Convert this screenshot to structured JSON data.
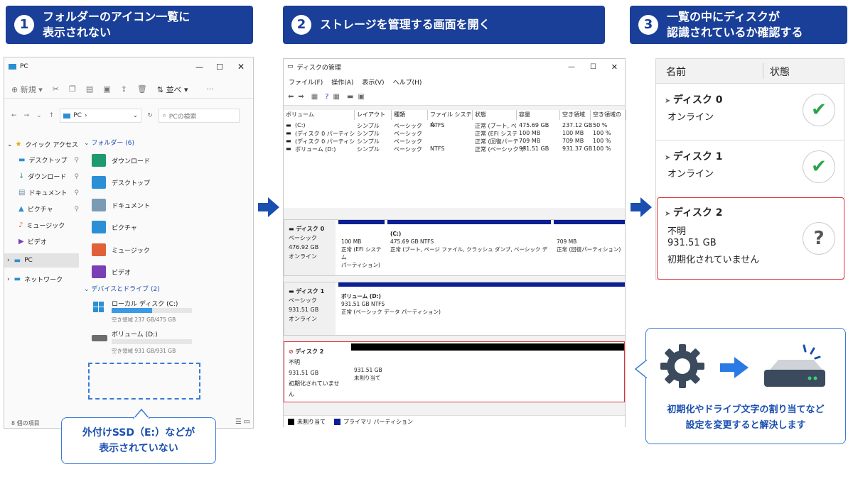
{
  "steps": [
    {
      "num": "1",
      "text": "フォルダーのアイコン一覧に\n表示されない"
    },
    {
      "num": "2",
      "text": "ストレージを管理する画面を開く"
    },
    {
      "num": "3",
      "text": "一覧の中にディスクが\n認識されているか確認する"
    }
  ],
  "explorer": {
    "title": "PC",
    "toolbar": {
      "new": "新規",
      "sort": "並べ",
      "view": "表示"
    },
    "address": "PC",
    "search_placeholder": "PCの検索",
    "nav": [
      {
        "label": "クイック アクセス",
        "icon": "star-icon"
      },
      {
        "label": "デスクトップ",
        "icon": "desktop-icon"
      },
      {
        "label": "ダウンロード",
        "icon": "download-icon"
      },
      {
        "label": "ドキュメント",
        "icon": "document-icon"
      },
      {
        "label": "ピクチャ",
        "icon": "picture-icon"
      },
      {
        "label": "ミュージック",
        "icon": "music-icon"
      },
      {
        "label": "ビデオ",
        "icon": "video-icon"
      },
      {
        "label": "PC",
        "icon": "pc-icon"
      },
      {
        "label": "ネットワーク",
        "icon": "network-icon"
      }
    ],
    "folders_header": "フォルダー (6)",
    "folders": [
      {
        "label": "ダウンロード",
        "color": "#1f9a6e"
      },
      {
        "label": "デスクトップ",
        "color": "#2b8fd6"
      },
      {
        "label": "ドキュメント",
        "color": "#7a9bb5"
      },
      {
        "label": "ピクチャ",
        "color": "#2c8fd6"
      },
      {
        "label": "ミュージック",
        "color": "#e0603a"
      },
      {
        "label": "ビデオ",
        "color": "#7a3fb5"
      }
    ],
    "drives_header": "デバイスとドライブ (2)",
    "drives": [
      {
        "label": "ローカル ディスク (C:)",
        "free": "空き領域 237 GB/475 GB",
        "fill": 0.5
      },
      {
        "label": "ボリューム (D:)",
        "free": "空き領域 931 GB/931 GB",
        "fill": 0.0
      }
    ],
    "status": "8 個の項目"
  },
  "callout_explorer": "外付けSSD（E:）などが\n表示されていない",
  "diskmgmt": {
    "title": "ディスクの管理",
    "menu": [
      "ファイル(F)",
      "操作(A)",
      "表示(V)",
      "ヘルプ(H)"
    ],
    "columns": [
      "ボリューム",
      "レイアウト",
      "種類",
      "ファイル システム",
      "状態",
      "容量",
      "空き領域",
      "空き領域の"
    ],
    "rows": [
      [
        "(C:)",
        "シンプル",
        "ベーシック",
        "NTFS",
        "正常 (ブート, ペ",
        "475.69 GB",
        "237.12 GB",
        "50 %"
      ],
      [
        "(ディスク 0 パーティシ",
        "シンプル",
        "ベーシック",
        "",
        "正常 (EFI システ",
        "100 MB",
        "100 MB",
        "100 %"
      ],
      [
        "(ディスク 0 パーティシ",
        "シンプル",
        "ベーシック",
        "",
        "正常 (回復パーテ",
        "709 MB",
        "709 MB",
        "100 %"
      ],
      [
        "ボリューム (D:)",
        "シンプル",
        "ベーシック",
        "NTFS",
        "正常 (ベーシック デ",
        "931.51 GB",
        "931.37 GB",
        "100 %"
      ]
    ],
    "disks": [
      {
        "name": "ディスク 0",
        "type": "ベーシック",
        "size": "476.92 GB",
        "state": "オンライン",
        "parts": [
          {
            "title": "",
            "l1": "100 MB",
            "l2": "正常 (EFI システム",
            "l3": "パーティション)"
          },
          {
            "title": "(C:)",
            "l1": "475.69 GB NTFS",
            "l2": "正常 (ブート, ページ ファイル, クラッシュ ダンプ, ベーシック データ パーティション)",
            "l3": ""
          },
          {
            "title": "",
            "l1": "709 MB",
            "l2": "正常 (回復パーティション)",
            "l3": ""
          }
        ]
      },
      {
        "name": "ディスク 1",
        "type": "ベーシック",
        "size": "931.51 GB",
        "state": "オンライン",
        "parts": [
          {
            "title": "ボリューム  (D:)",
            "l1": "931.51 GB NTFS",
            "l2": "正常 (ベーシック データ パーティション)",
            "l3": ""
          }
        ]
      },
      {
        "name": "ディスク 2",
        "type": "不明",
        "size": "931.51 GB",
        "state": "初期化されていません",
        "parts": [
          {
            "title": "",
            "l1": "931.51 GB",
            "l2": "未割り当て",
            "l3": ""
          }
        ]
      }
    ],
    "legend": [
      {
        "label": "未割り当て",
        "color": "#000000"
      },
      {
        "label": "プライマリ パーティション",
        "color": "#0a1e96"
      }
    ]
  },
  "panel": {
    "headers": [
      "名前",
      "状態"
    ],
    "disks": [
      {
        "name": "ディスク 0",
        "lines": [
          "オンライン"
        ],
        "status": "ok"
      },
      {
        "name": "ディスク 1",
        "lines": [
          "オンライン"
        ],
        "status": "ok"
      },
      {
        "name": "ディスク 2",
        "lines": [
          "不明",
          "931.51 GB",
          "初期化されていません"
        ],
        "status": "unknown"
      }
    ]
  },
  "solution": "初期化やドライブ文字の割り当てなど\n設定を変更すると解決します",
  "colors": {
    "step_bg": "#1a3f98",
    "accent": "#1a4fb0",
    "highlight": "#e0303a",
    "ok": "#2fa34a"
  }
}
